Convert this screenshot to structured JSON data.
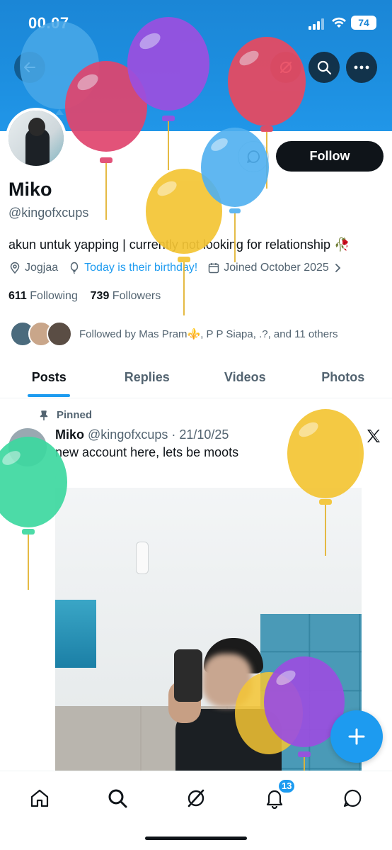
{
  "status_bar": {
    "time": "00.07",
    "battery": "74"
  },
  "profile": {
    "name": "Miko",
    "handle": "@kingofxcups",
    "bio": "akun untuk yapping | currently not looking for relationship 🥀",
    "location": "Jogjaa",
    "birthday": "Today is their birthday!",
    "joined": "Joined October 2025",
    "following_count": "611",
    "following_label": "Following",
    "followers_count": "739",
    "followers_label": "Followers",
    "followed_by": "Followed by Mas Pram⚜️, P P Siapa, .?, and 11 others"
  },
  "header": {
    "follow_label": "Follow"
  },
  "tabs": [
    {
      "label": "Posts",
      "active": true
    },
    {
      "label": "Replies",
      "active": false
    },
    {
      "label": "Videos",
      "active": false
    },
    {
      "label": "Photos",
      "active": false
    }
  ],
  "post": {
    "pinned_label": "Pinned",
    "author": "Miko",
    "handle_date": "@kingofxcups · 21/10/25",
    "text": "new account here, lets be moots"
  },
  "nav": {
    "notifications_badge": "13"
  },
  "colors": {
    "accent": "#1d9bf0",
    "banner": "#1d8fe0",
    "text_primary": "#0f1419",
    "text_secondary": "#536471"
  },
  "balloon_colors": [
    "#49a8e8",
    "#e0456e",
    "#9b4fe0",
    "#e9495f",
    "#f4c534",
    "#4fb0f0",
    "#3dd8a0",
    "#f4c534",
    "#9b4fe0",
    "#f4c534"
  ]
}
